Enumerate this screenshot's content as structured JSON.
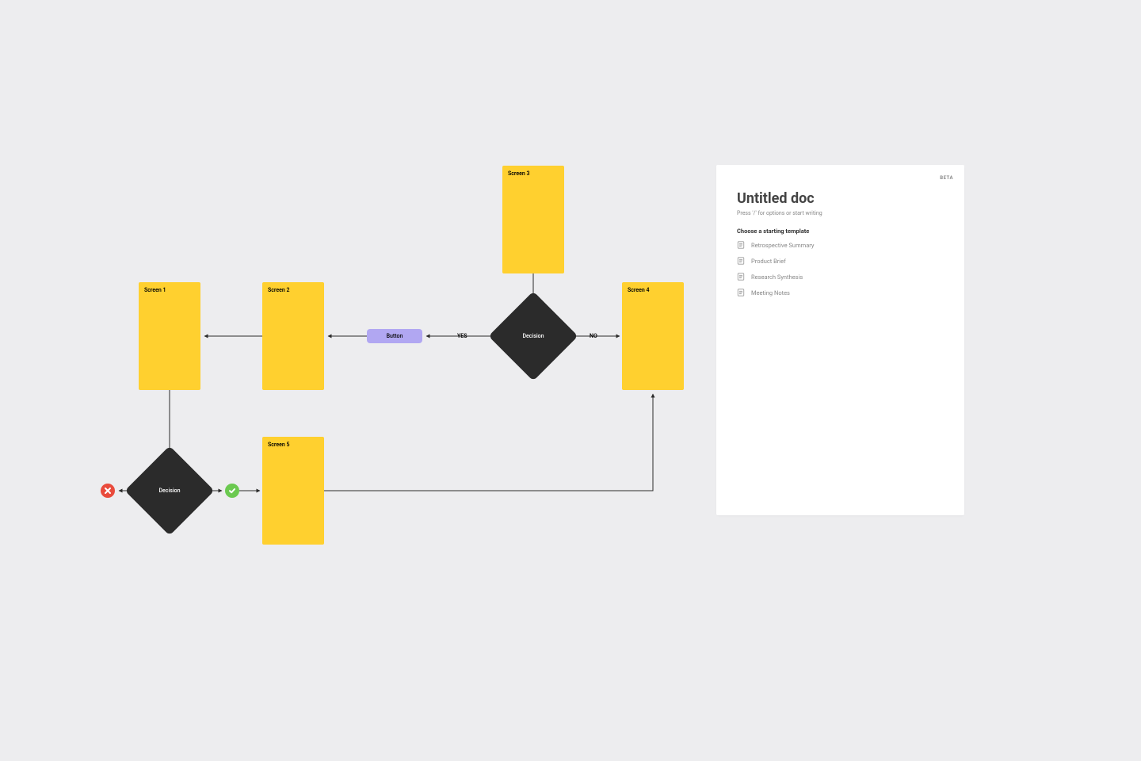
{
  "flow": {
    "screens": {
      "s1": "Screen 1",
      "s2": "Screen 2",
      "s3": "Screen 3",
      "s4": "Screen 4",
      "s5": "Screen 5"
    },
    "button": "Button",
    "decision1": "Decision",
    "decision2": "Decision",
    "yes": "YES",
    "no": "NO"
  },
  "doc": {
    "badge": "BETA",
    "title": "Untitled doc",
    "hint": "Press '/' for options or start writing",
    "section": "Choose a starting template",
    "templates": [
      "Retrospective Summary",
      "Product Brief",
      "Research Synthesis",
      "Meeting Notes"
    ]
  }
}
